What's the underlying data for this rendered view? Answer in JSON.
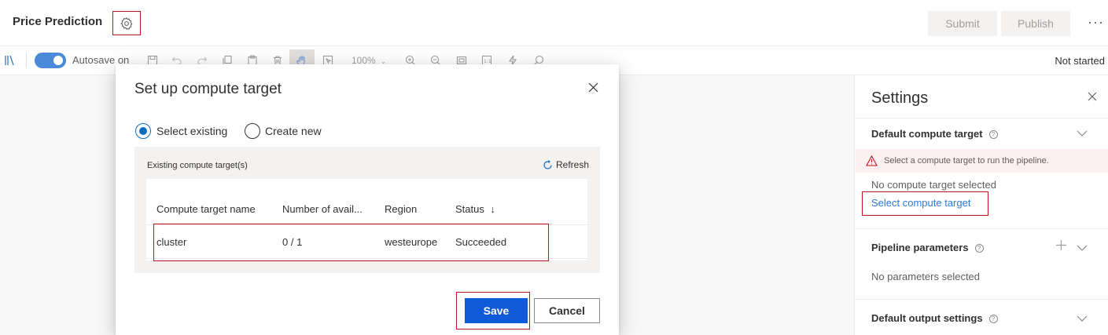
{
  "header": {
    "title": "Price Prediction",
    "submit_label": "Submit",
    "publish_label": "Publish",
    "more_label": "···"
  },
  "toolbar": {
    "autosave_label": "Autosave on",
    "autosave_on": true,
    "zoom_label": "100%",
    "run_status": "Not started"
  },
  "settings": {
    "title": "Settings",
    "compute": {
      "title": "Default compute target",
      "warning": "Select a compute target to run the pipeline.",
      "empty_text": "No compute target selected",
      "select_link": "Select compute target"
    },
    "parameters": {
      "title": "Pipeline parameters",
      "empty_text": "No parameters selected"
    },
    "output": {
      "title": "Default output settings"
    }
  },
  "dialog": {
    "title": "Set up compute target",
    "options": [
      {
        "label": "Select existing",
        "selected": true
      },
      {
        "label": "Create new",
        "selected": false
      }
    ],
    "list_label": "Existing compute target(s)",
    "refresh_label": "Refresh",
    "columns": [
      "Compute target name",
      "Number of avail...",
      "Region",
      "Status"
    ],
    "sort_indicator": "↓",
    "rows": [
      {
        "name": "cluster",
        "nodes": "0 / 1",
        "region": "westeurope",
        "status": "Succeeded"
      }
    ],
    "save_label": "Save",
    "cancel_label": "Cancel"
  },
  "colors": {
    "accent": "#0f5ad8",
    "highlight_border": "#c50f1f",
    "link": "#2b7ad5",
    "toggle": "#4a8ad8",
    "warning_bg": "#fdf0f0"
  }
}
